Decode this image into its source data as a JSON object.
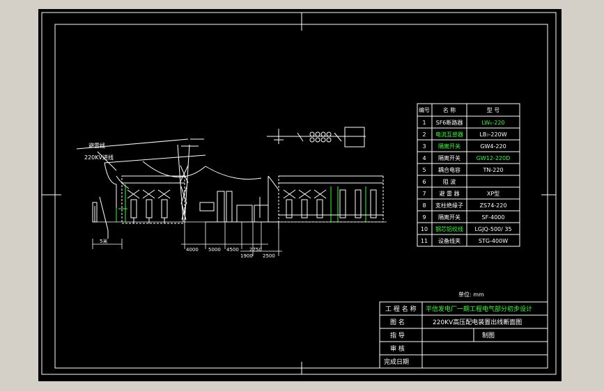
{
  "colors": {
    "background": "#000000",
    "line": "#ffffff",
    "green": "#33ff33",
    "cyan": "#00ffff",
    "app": "#d4d0c8"
  },
  "diagram": {
    "labels": {
      "left_line1": "避雷线",
      "left_line2": "220KV进线"
    },
    "dimensions": [
      "4000",
      "5000",
      "4500",
      "2750",
      "1900",
      "2500"
    ],
    "left_dim": "5米",
    "unit": "单位: mm"
  },
  "equipment_table": {
    "headers": [
      "编号",
      "名 称",
      "型 号"
    ],
    "rows": [
      {
        "no": "1",
        "name": "SF6断路器",
        "model": "LW₆-220",
        "name_green": false,
        "model_green": true
      },
      {
        "no": "2",
        "name": "电流互感器",
        "model": "LB₇-220W",
        "name_green": true,
        "model_green": false
      },
      {
        "no": "3",
        "name": "隔离开关",
        "model": "GW4-220",
        "name_green": true,
        "model_green": false
      },
      {
        "no": "4",
        "name": "隔离开关",
        "model": "GW12-220D",
        "name_green": false,
        "model_green": true
      },
      {
        "no": "5",
        "name": "耦合电容",
        "model": "TN-220",
        "name_green": false,
        "model_green": false
      },
      {
        "no": "6",
        "name": "阻 波",
        "model": "",
        "name_green": false,
        "model_green": false
      },
      {
        "no": "7",
        "name": "避 雷 器",
        "model": "XP型",
        "name_green": false,
        "model_green": false
      },
      {
        "no": "8",
        "name": "支柱绝缘子",
        "model": "ZS74-220",
        "name_green": false,
        "model_green": false
      },
      {
        "no": "9",
        "name": "隔离开关",
        "model": "SF-4000",
        "name_green": false,
        "model_green": false
      },
      {
        "no": "10",
        "name": "钢芯铝绞线",
        "model": "LGJQ-500/ 35",
        "name_green": true,
        "model_green": false
      },
      {
        "no": "11",
        "name": "设备线夹",
        "model": "STG-400W",
        "name_green": false,
        "model_green": false
      }
    ]
  },
  "title_block": {
    "project_label": "工 程 名 称",
    "project_name": "平信发电厂一期工程电气部分初步设计",
    "drawing_label": "图 名",
    "drawing_name": "220KV高压配电装置出线断面图",
    "guide_label": "指 导",
    "drawn_label": "制图",
    "review_label": "审 核",
    "date_label": "完成日期"
  }
}
